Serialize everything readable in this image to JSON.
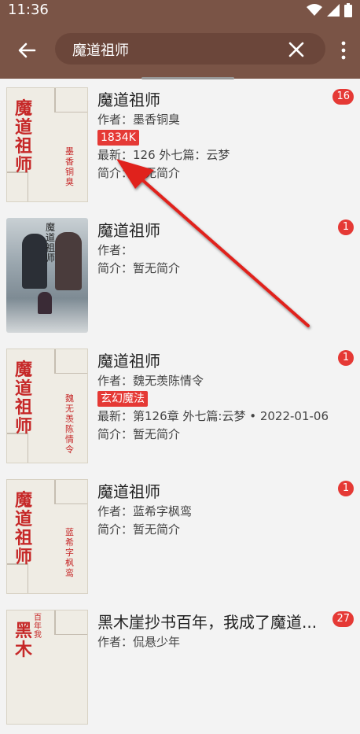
{
  "status": {
    "time": "11:36",
    "icons": [
      "wifi-icon",
      "signal-icon",
      "battery-icon"
    ]
  },
  "search": {
    "value": "魔道祖师"
  },
  "books": [
    {
      "name": "魔道祖师",
      "author": "作者：墨香铜臭",
      "tag": "1834K",
      "latest": "最新：126 外七篇：云梦",
      "intro": "简介：暂无简介",
      "badge": "16",
      "cover_title": "魔道祖师",
      "cover_author": "墨香铜臭"
    },
    {
      "name": "魔道祖师",
      "author": "作者：",
      "intro": "简介：暂无简介",
      "badge": "1",
      "cover_title": "魔道祖师"
    },
    {
      "name": "魔道祖师",
      "author": "作者：魏无羡陈情令",
      "tag": "玄幻魔法",
      "latest": "最新：第126章 外七篇:云梦 • 2022-01-06",
      "intro": "简介：暂无简介",
      "badge": "1",
      "cover_title": "魔道祖师",
      "cover_author": "魏无羡陈情令"
    },
    {
      "name": "魔道祖师",
      "author": "作者：蓝希字枫鸾",
      "intro": "简介：暂无简介",
      "badge": "1",
      "cover_title": "魔道祖师",
      "cover_author": "蓝希字枫鸾"
    },
    {
      "name": "黑木崖抄书百年，我成了魔道...",
      "author": "作者：侃悬少年",
      "badge": "27",
      "cover_title": "黑木",
      "cover_author": "百年我"
    }
  ],
  "colors": {
    "topbar": "#7a5446",
    "accent": "#e53935",
    "annotation_arrow": "#e0201e"
  }
}
